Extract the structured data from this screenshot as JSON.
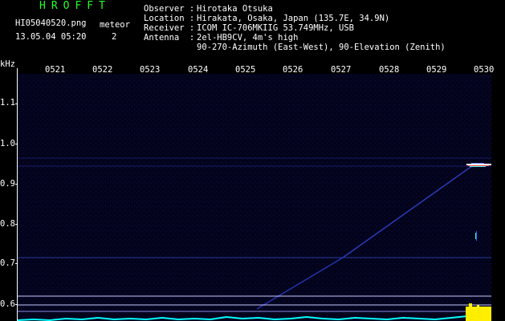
{
  "header": {
    "brand": "HROFFT",
    "filename": "HI05040520.png",
    "event_label": "meteor",
    "datetime": "13.05.04 05:20",
    "event_count": "2",
    "observer_label": "Observer :",
    "observer_value": "Hirotaka Otsuka",
    "location_label": "Location :",
    "location_value": "Hirakata, Osaka, Japan (135.7E, 34.9N)",
    "receiver_label": "Receiver :",
    "receiver_value": "ICOM IC-706MKIIG 53.749MHz, USB",
    "antenna_label": "Antenna  :",
    "antenna_value": "2el-HB9CV, 4m's high",
    "antenna_value2": "90-270-Azimuth (East-West), 90-Elevation (Zenith)"
  },
  "axis": {
    "unit": "kHz",
    "time_labels": [
      "0521",
      "0522",
      "0523",
      "0524",
      "0525",
      "0526",
      "0527",
      "0528",
      "0529",
      "0530"
    ],
    "freq_labels": [
      "1.1",
      "1.0",
      "0.9",
      "0.8",
      "0.7",
      "0.6"
    ]
  },
  "colors": {
    "background": "#000000",
    "plot_bg": "#03031c",
    "brand_green": "#22ff22",
    "meteor_trace": "#2233aa",
    "carrier_line": "#c8c8ff",
    "noise_floor": "#00ffff",
    "signal_peak": "#ffee00"
  }
}
